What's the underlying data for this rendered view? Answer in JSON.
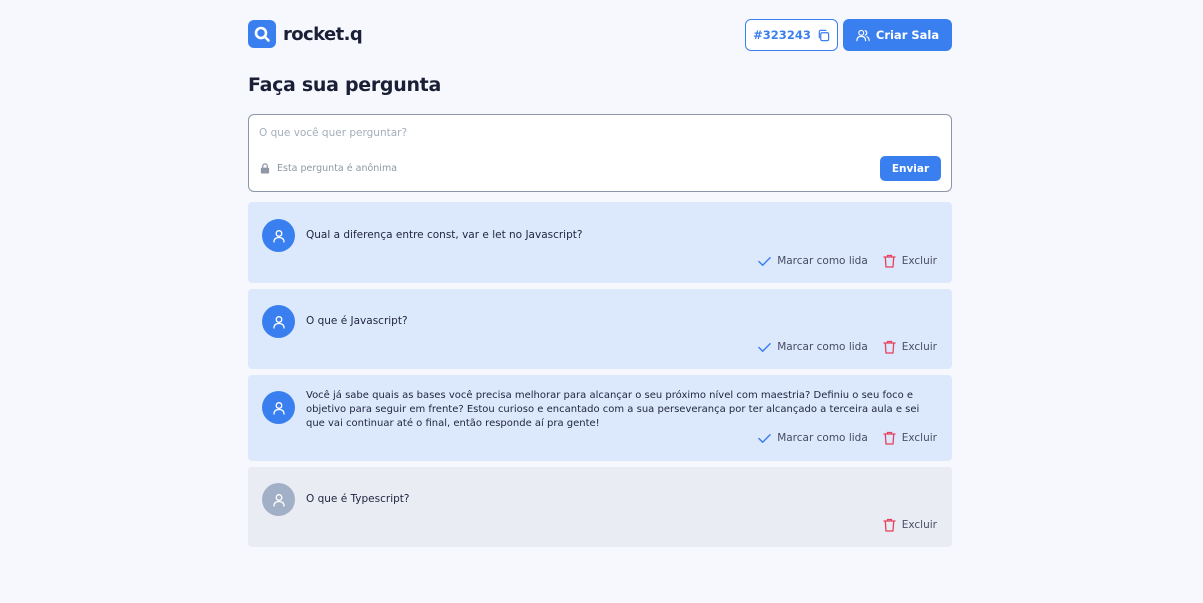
{
  "header": {
    "logo_text": "rocket.q",
    "room_code": "#323243",
    "create_room_label": "Criar Sala"
  },
  "title": "Faça sua pergunta",
  "form": {
    "placeholder": "O que você quer perguntar?",
    "anonymous_note": "Esta pergunta é anônima",
    "send_label": "Enviar"
  },
  "actions": {
    "mark_read_label": "Marcar como lida",
    "delete_label": "Excluir"
  },
  "questions": [
    {
      "text": "Qual a diferença entre const, var e let no Javascript?",
      "read": false
    },
    {
      "text": "O que é Javascript?",
      "read": false
    },
    {
      "text": "Você já sabe quais as bases você precisa melhorar para alcançar o seu próximo nível com maestria? Definiu o seu foco e objetivo para seguir em frente? Estou curioso e encantado com a sua perseverança por ter alcançado a terceira aula e sei que vai continuar até o final, então responde aí pra gente!",
      "read": false
    },
    {
      "text": "O que é Typescript?",
      "read": true
    }
  ],
  "colors": {
    "accent": "#3A7FF0",
    "delete": "#E73F5D",
    "card_unread": "#DCE9FC",
    "card_read": "#E9ECF2",
    "background": "#F6F8FE"
  }
}
